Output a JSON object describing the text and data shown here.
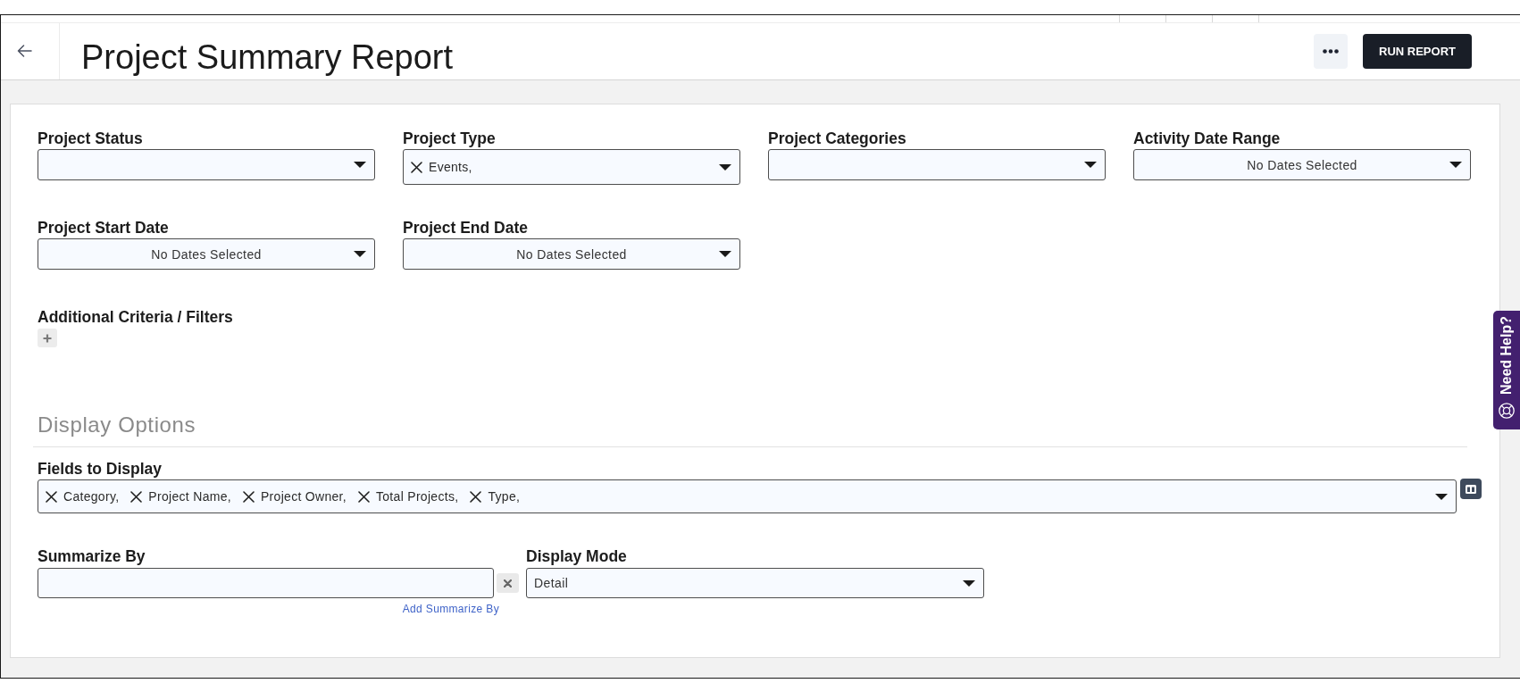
{
  "header": {
    "title": "Project Summary Report",
    "run_button": "RUN REPORT"
  },
  "criteria": {
    "fields": [
      {
        "kind": "select",
        "label": "Project Status"
      },
      {
        "kind": "select",
        "label": "Project Type",
        "tags": [
          "Events,"
        ]
      },
      {
        "kind": "select",
        "label": "Project Categories"
      },
      {
        "kind": "date",
        "label": "Activity Date Range",
        "value": "No Dates Selected"
      },
      {
        "kind": "date",
        "label": "Project Start Date",
        "value": "No Dates Selected"
      },
      {
        "kind": "date",
        "label": "Project End Date",
        "value": "No Dates Selected"
      }
    ],
    "additional_label": "Additional Criteria / Filters"
  },
  "display_options": {
    "title": "Display Options",
    "fields_to_display": {
      "label": "Fields to Display",
      "tags": [
        "Category,",
        "Project Name,",
        "Project Owner,",
        "Total Projects,",
        "Type,"
      ]
    },
    "summarize_by": {
      "label": "Summarize By",
      "link": "Add Summarize By"
    },
    "display_mode": {
      "label": "Display Mode",
      "value": "Detail"
    }
  },
  "help_tab": {
    "label": "Need Help?"
  }
}
